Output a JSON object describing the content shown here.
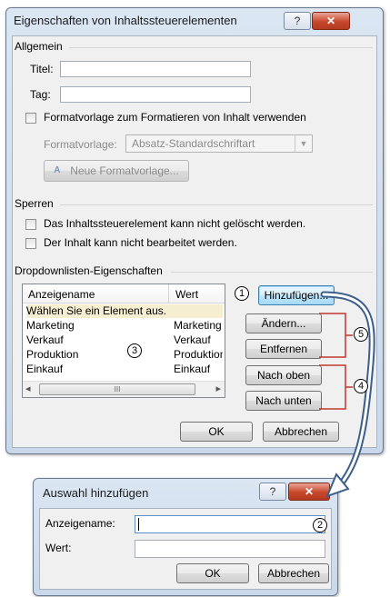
{
  "dialog1": {
    "title": "Eigenschaften von Inhaltssteuerelementen",
    "help_glyph": "?",
    "close_glyph": "✕",
    "general": {
      "group": "Allgemein",
      "title_label": "Titel:",
      "tag_label": "Tag:",
      "title_value": "",
      "tag_value": "",
      "use_style_label": "Formatvorlage zum Formatieren von Inhalt verwenden",
      "style_label": "Formatvorlage:",
      "style_value": "Absatz-Standardschriftart",
      "new_style_button": "Neue Formatvorlage..."
    },
    "locking": {
      "group": "Sperren",
      "cannot_delete": "Das Inhaltssteuerelement kann nicht gelöscht werden.",
      "cannot_edit": "Der Inhalt kann nicht bearbeitet werden."
    },
    "dropdown": {
      "group": "Dropdownlisten-Eigenschaften",
      "columns": [
        "Anzeigename",
        "Wert"
      ],
      "rows": [
        {
          "name": "Wählen Sie ein Element aus.",
          "value": ""
        },
        {
          "name": "Marketing",
          "value": "Marketing"
        },
        {
          "name": "Verkauf",
          "value": "Verkauf"
        },
        {
          "name": "Produktion",
          "value": "Produktion"
        },
        {
          "name": "Einkauf",
          "value": "Einkauf"
        }
      ],
      "scroll_left": "◂",
      "scroll_right": "▸",
      "scroll_thumb": "III",
      "add_button": "Hinzufügen...",
      "edit_button": "Ändern...",
      "remove_button": "Entfernen",
      "up_button": "Nach oben",
      "down_button": "Nach unten"
    },
    "ok_button": "OK",
    "cancel_button": "Abbrechen"
  },
  "dialog2": {
    "title": "Auswahl hinzufügen",
    "help_glyph": "?",
    "close_glyph": "✕",
    "display_name_label": "Anzeigename:",
    "value_label": "Wert:",
    "display_name_value": "",
    "value_value": "",
    "ok_button": "OK",
    "cancel_button": "Abbrechen"
  },
  "callouts": [
    "1",
    "2",
    "3",
    "4",
    "5"
  ],
  "colors": {
    "arrow": "#3d5f8a",
    "bracket": "#c0392b",
    "accent": "#3c7fb1"
  }
}
